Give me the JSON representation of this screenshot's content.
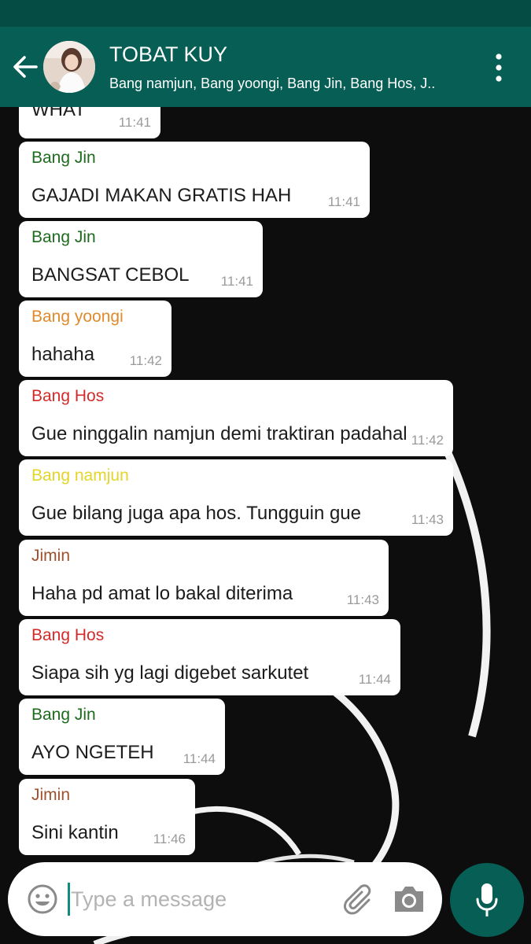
{
  "header": {
    "title": "TOBAT KUY",
    "subtitle": "Bang namjun, Bang yoongi, Bang Jin, Bang Hos, J..",
    "back_icon": "arrow-left-icon",
    "menu_icon": "more-vertical-icon"
  },
  "colors": {
    "app_bar": "#075e54",
    "status_bar": "#054d44",
    "bubble": "#ffffff",
    "time": "#9a9a9a",
    "mic_button": "#075e54",
    "sender_bang_jin": "#1e6b1e",
    "sender_bang_yoongi": "#e08a2c",
    "sender_bang_hos": "#d42a2a",
    "sender_bang_namjun": "#e3d52a",
    "sender_jimin": "#a0522d"
  },
  "messages": [
    {
      "sender": "",
      "text": "WHAT",
      "time": "11:41"
    },
    {
      "sender": "Bang Jin",
      "text": "GAJADI MAKAN GRATIS HAH",
      "time": "11:41"
    },
    {
      "sender": "Bang Jin",
      "text": "BANGSAT CEBOL",
      "time": "11:41"
    },
    {
      "sender": "Bang yoongi",
      "text": "hahaha",
      "time": "11:42"
    },
    {
      "sender": "Bang Hos",
      "text": "Gue ninggalin namjun demi traktiran padahal",
      "time": "11:42"
    },
    {
      "sender": "Bang namjun",
      "text": "Gue bilang juga apa hos. Tungguin gue",
      "time": "11:43"
    },
    {
      "sender": "Jimin",
      "text": "Haha pd amat lo bakal diterima",
      "time": "11:43"
    },
    {
      "sender": "Bang Hos",
      "text": "Siapa sih yg lagi digebet sarkutet",
      "time": "11:44"
    },
    {
      "sender": "Bang Jin",
      "text": "AYO NGETEH",
      "time": "11:44"
    },
    {
      "sender": "Jimin",
      "text": "Sini kantin",
      "time": "11:46"
    }
  ],
  "composer": {
    "placeholder": "Type a message",
    "value": "",
    "emoji_icon": "smiley-icon",
    "attach_icon": "paperclip-icon",
    "camera_icon": "camera-icon",
    "mic_icon": "microphone-icon"
  }
}
